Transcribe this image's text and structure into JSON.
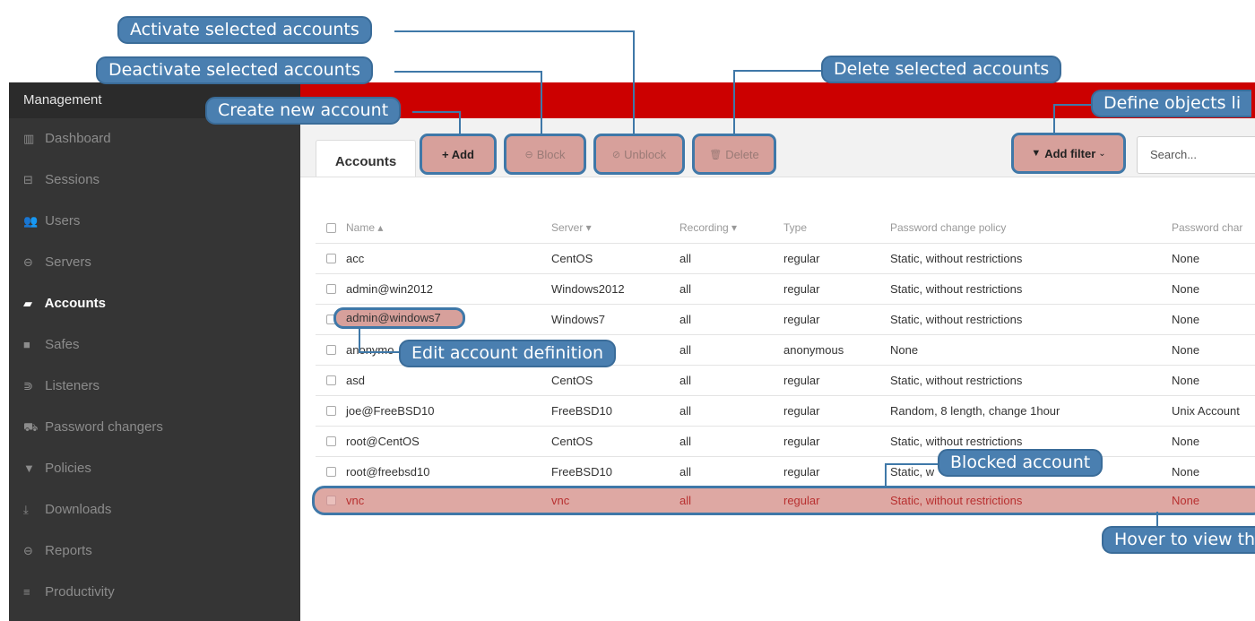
{
  "sidebar": {
    "title": "Management",
    "items": [
      {
        "icon": "▥",
        "label": "Dashboard"
      },
      {
        "icon": "⊟",
        "label": "Sessions"
      },
      {
        "icon": "👥",
        "label": "Users"
      },
      {
        "icon": "⊖",
        "label": "Servers"
      },
      {
        "icon": "▰",
        "label": "Accounts"
      },
      {
        "icon": "■",
        "label": "Safes"
      },
      {
        "icon": "⋑",
        "label": "Listeners"
      },
      {
        "icon": "⛟",
        "label": "Password changers"
      },
      {
        "icon": "▼",
        "label": "Policies"
      },
      {
        "icon": "⤓",
        "label": "Downloads"
      },
      {
        "icon": "⊖",
        "label": "Reports"
      },
      {
        "icon": "≡",
        "label": "Productivity"
      }
    ]
  },
  "tab": {
    "label": "Accounts"
  },
  "toolbar": {
    "add": "+ Add",
    "block": "Block",
    "unblock": "Unblock",
    "delete": "Delete",
    "add_filter": "Add filter",
    "search_placeholder": "Search..."
  },
  "table": {
    "headers": [
      "Name ▴",
      "Server ▾",
      "Recording ▾",
      "Type",
      "Password change policy",
      "Password char"
    ],
    "rows": [
      [
        "acc",
        "CentOS",
        "all",
        "regular",
        "Static, without restrictions",
        "None"
      ],
      [
        "admin@win2012",
        "Windows2012",
        "all",
        "regular",
        "Static, without restrictions",
        "None"
      ],
      [
        "admin@windows7",
        "Windows7",
        "all",
        "regular",
        "Static, without restrictions",
        "None"
      ],
      [
        "anonymo",
        "",
        "all",
        "anonymous",
        "None",
        "None"
      ],
      [
        "asd",
        "CentOS",
        "all",
        "regular",
        "Static, without restrictions",
        "None"
      ],
      [
        "joe@FreeBSD10",
        "FreeBSD10",
        "all",
        "regular",
        "Random, 8 length, change 1hour",
        "Unix Account"
      ],
      [
        "root@CentOS",
        "CentOS",
        "all",
        "regular",
        "Static, without restrictions",
        "None"
      ],
      [
        "root@freebsd10",
        "FreeBSD10",
        "all",
        "regular",
        "Static, w",
        "None"
      ],
      [
        "vnc",
        "vnc",
        "all",
        "regular",
        "Static, without restrictions",
        "None"
      ]
    ]
  },
  "callouts": {
    "activate": "Activate selected accounts",
    "deactivate": "Deactivate selected accounts",
    "create": "Create new account",
    "delete": "Delete selected accounts",
    "define": "Define objects li",
    "edit": "Edit account definition",
    "blocked": "Blocked account",
    "hover": "Hover to view th"
  },
  "colors": {
    "topbar": "#cc0000",
    "sidebar": "#353535",
    "callout": "#4a7fb0",
    "highlight": "#d7a09b"
  }
}
